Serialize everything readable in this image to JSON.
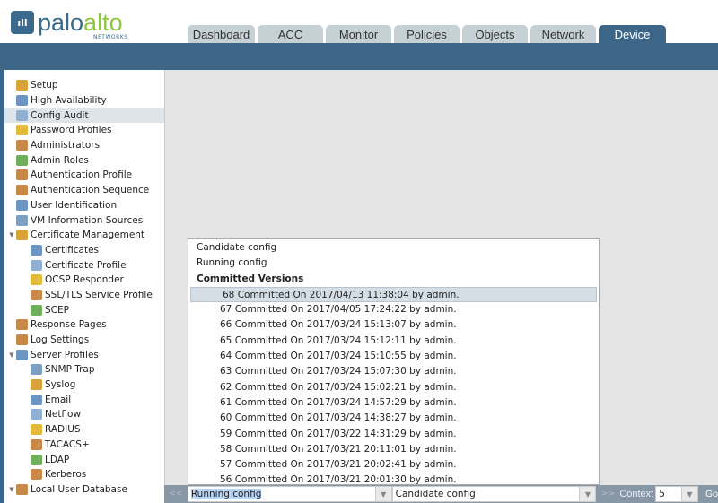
{
  "logo": {
    "mark": "ıll",
    "word1": "palo",
    "word2": "alto",
    "sub": "NETWORKS"
  },
  "tabs": [
    {
      "label": "Dashboard",
      "w": 75
    },
    {
      "label": "ACC",
      "w": 73
    },
    {
      "label": "Monitor",
      "w": 73
    },
    {
      "label": "Policies",
      "w": 73
    },
    {
      "label": "Objects",
      "w": 73
    },
    {
      "label": "Network",
      "w": 73
    },
    {
      "label": "Device",
      "w": 75,
      "active": true
    }
  ],
  "sidebar": [
    {
      "label": "Setup",
      "level": 0
    },
    {
      "label": "High Availability",
      "level": 0
    },
    {
      "label": "Config Audit",
      "level": 0,
      "selected": true
    },
    {
      "label": "Password Profiles",
      "level": 0
    },
    {
      "label": "Administrators",
      "level": 0
    },
    {
      "label": "Admin Roles",
      "level": 0
    },
    {
      "label": "Authentication Profile",
      "level": 0
    },
    {
      "label": "Authentication Sequence",
      "level": 0
    },
    {
      "label": "User Identification",
      "level": 0
    },
    {
      "label": "VM Information Sources",
      "level": 0
    },
    {
      "label": "Certificate Management",
      "level": 0,
      "expanded": true
    },
    {
      "label": "Certificates",
      "level": 1
    },
    {
      "label": "Certificate Profile",
      "level": 1
    },
    {
      "label": "OCSP Responder",
      "level": 1
    },
    {
      "label": "SSL/TLS Service Profile",
      "level": 1
    },
    {
      "label": "SCEP",
      "level": 1
    },
    {
      "label": "Response Pages",
      "level": 0
    },
    {
      "label": "Log Settings",
      "level": 0
    },
    {
      "label": "Server Profiles",
      "level": 0,
      "expanded": true
    },
    {
      "label": "SNMP Trap",
      "level": 1
    },
    {
      "label": "Syslog",
      "level": 1
    },
    {
      "label": "Email",
      "level": 1
    },
    {
      "label": "Netflow",
      "level": 1
    },
    {
      "label": "RADIUS",
      "level": 1
    },
    {
      "label": "TACACS+",
      "level": 1
    },
    {
      "label": "LDAP",
      "level": 1
    },
    {
      "label": "Kerberos",
      "level": 1
    },
    {
      "label": "Local User Database",
      "level": 0,
      "expanded": true
    }
  ],
  "dropdown": {
    "options": [
      "Candidate config",
      "Running config"
    ],
    "section": "Committed Versions",
    "versions": [
      "68 Committed On 2017/04/13 11:38:04 by admin.",
      "67 Committed On 2017/04/05 17:24:22 by admin.",
      "66 Committed On 2017/03/24 15:13:07 by admin.",
      "65 Committed On 2017/03/24 15:12:11 by admin.",
      "64 Committed On 2017/03/24 15:10:55 by admin.",
      "63 Committed On 2017/03/24 15:07:30 by admin.",
      "62 Committed On 2017/03/24 15:02:21 by admin.",
      "61 Committed On 2017/03/24 14:57:29 by admin.",
      "60 Committed On 2017/03/24 14:38:27 by admin.",
      "59 Committed On 2017/03/22 14:31:29 by admin.",
      "58 Committed On 2017/03/21 20:11:01 by admin.",
      "57 Committed On 2017/03/21 20:02:41 by admin.",
      "56 Committed On 2017/03/21 20:01:30 by admin."
    ]
  },
  "bottom": {
    "prev": "<<",
    "left_value": "Running config",
    "right_value": "Candidate config",
    "next": ">>",
    "context_label": "Context",
    "context_value": "5",
    "go": "Go"
  }
}
